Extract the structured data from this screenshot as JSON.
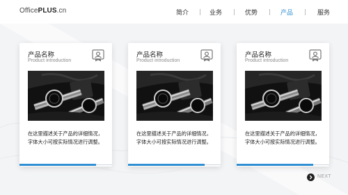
{
  "header": {
    "logo": {
      "prefix": "Office",
      "brand": "PLUS",
      "suffix": ".cn"
    },
    "nav": [
      {
        "label": "简介",
        "active": false
      },
      {
        "label": "业务",
        "active": false
      },
      {
        "label": "优势",
        "active": false
      },
      {
        "label": "产品",
        "active": true
      },
      {
        "label": "服务",
        "active": false
      }
    ]
  },
  "cards": [
    {
      "title": "产品名称",
      "subtitle": "Product introduction",
      "icon": "badge-icon",
      "image": "watch-photo",
      "description": "在这里描述关于产品的详细情况，字体大小可按实际情况进行调整。"
    },
    {
      "title": "产品名称",
      "subtitle": "Product introduction",
      "icon": "badge-icon",
      "image": "watch-photo",
      "description": "在这里描述关于产品的详细情况，字体大小可按实际情况进行调整。"
    },
    {
      "title": "产品名称",
      "subtitle": "Product introduction",
      "icon": "badge-icon",
      "image": "watch-photo",
      "description": "在这里描述关于产品的详细情况，字体大小可按实际情况进行调整。"
    }
  ],
  "pager": {
    "next_label": "NEXT",
    "icon": "chevron-right-circle-icon"
  },
  "colors": {
    "accent": "#2f8fd3",
    "text": "#222222",
    "subtext": "#8a8a8a",
    "background": "#f3f4f6"
  }
}
